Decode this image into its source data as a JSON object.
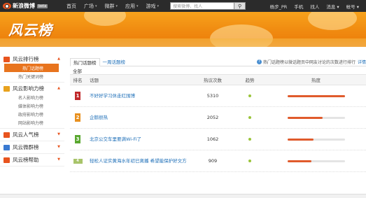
{
  "topnav": {
    "logo_text": "新浪微博",
    "beta": "beta",
    "items": [
      {
        "label": "首页",
        "caret": false
      },
      {
        "label": "广场",
        "caret": true
      },
      {
        "label": "微群",
        "caret": true
      },
      {
        "label": "应用",
        "caret": true
      },
      {
        "label": "游戏",
        "caret": true
      }
    ],
    "search_placeholder": "搜索微博、找人",
    "user": "杨步_PR",
    "right_items": [
      "手机",
      "找人",
      "消息 ▾",
      "帐号 ▾"
    ]
  },
  "banner": {
    "brand": "风云榜"
  },
  "sidebar": {
    "groups": [
      {
        "label": "风云排行榜",
        "icon": "chart-icon",
        "color": "#e8541e",
        "expanded": true,
        "items": [
          {
            "label": "热门话题榜",
            "active": true
          },
          {
            "label": "热门关键词榜",
            "active": false
          }
        ]
      },
      {
        "label": "风云影响力榜",
        "icon": "influence-icon",
        "color": "#e8a21e",
        "expanded": true,
        "items": [
          {
            "label": "名人影响力榜",
            "active": false
          },
          {
            "label": "媒体影响力榜",
            "active": false
          },
          {
            "label": "政府影响力榜",
            "active": false
          },
          {
            "label": "网站影响力榜",
            "active": false
          }
        ]
      },
      {
        "label": "风云人气榜",
        "icon": "popularity-icon",
        "color": "#e8541e",
        "expanded": false,
        "items": []
      },
      {
        "label": "风云微群榜",
        "icon": "group-icon",
        "color": "#3a7ad1",
        "expanded": false,
        "items": []
      },
      {
        "label": "风云榜帮助",
        "icon": "help-icon",
        "color": "#e8541e",
        "expanded": false,
        "items": []
      }
    ]
  },
  "main": {
    "tabs": [
      {
        "label": "热门话题榜",
        "active": true
      },
      {
        "label": "一周话题榜",
        "active": false
      }
    ],
    "tip": "热门话题榜以微话题页中网友讨论的次数进行排行",
    "tip_more": "详情",
    "subtab": "全部",
    "columns": {
      "rank": "排名",
      "topic": "话题",
      "count": "热议次数",
      "trend": "趋势",
      "heat": "热度"
    },
    "rows": [
      {
        "rank": "1",
        "badge_color": "#c0292b",
        "topic": "不好好学习休走红围博",
        "count": "5310",
        "heat": 1.0
      },
      {
        "rank": "2",
        "badge_color": "#e8901e",
        "topic": "企鹅很热",
        "count": "2052",
        "heat": 0.62
      },
      {
        "rank": "3",
        "badge_color": "#5aa830",
        "topic": "北京公交车里要满Wi-Fi了",
        "count": "1062",
        "heat": 0.46
      },
      {
        "rank": "4",
        "badge_color": "#a8c46a",
        "topic": "轻松人证实黄海水年初已离播 希望能保护好文方",
        "count": "909",
        "heat": 0.42
      }
    ]
  }
}
